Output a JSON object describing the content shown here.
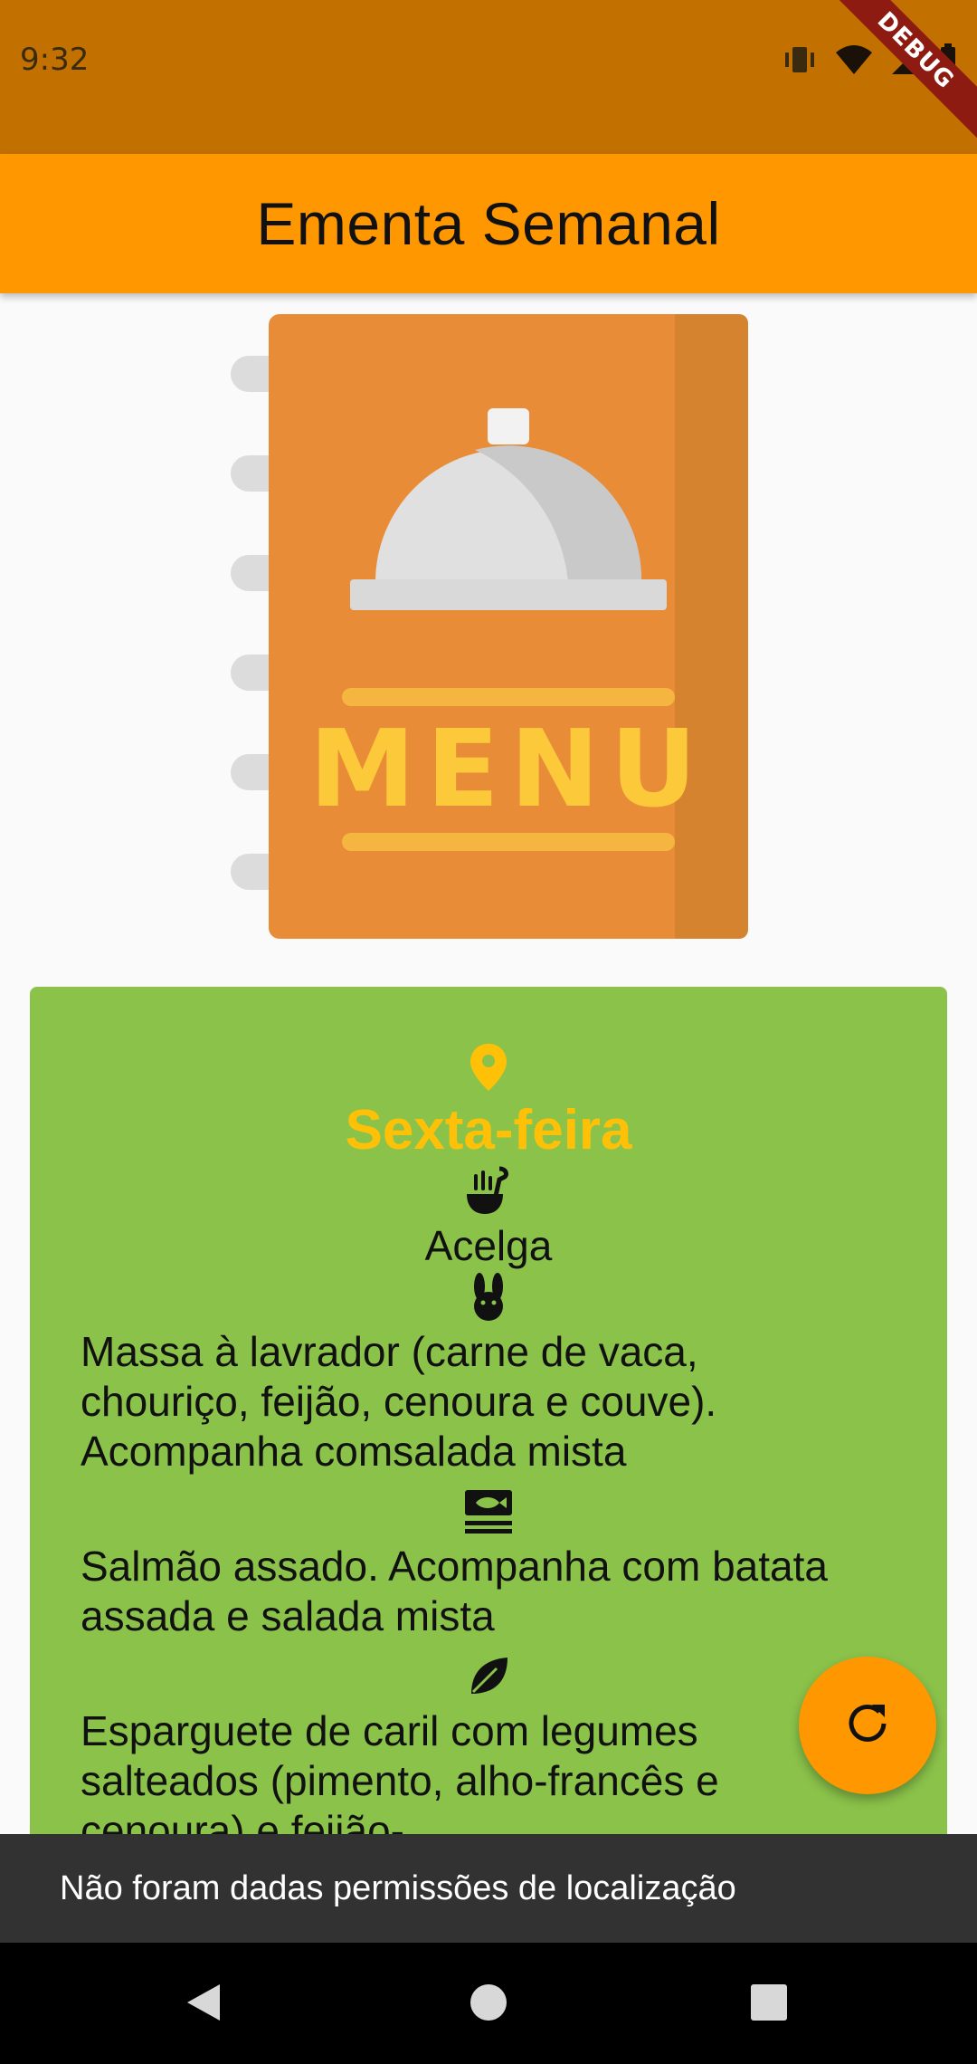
{
  "status_bar": {
    "time": "9:32",
    "icons": [
      "vibrate-icon",
      "wifi-icon",
      "signal-icon",
      "battery-icon"
    ]
  },
  "debug_banner": "DEBUG",
  "app_bar": {
    "title": "Ementa Semanal"
  },
  "menu_image": {
    "text": "MENU"
  },
  "card": {
    "day": "Sexta-feira",
    "location_icon": "location-pin-icon",
    "soup_icon": "soup-ladle-icon",
    "soup": "Acelga",
    "meat_icon": "rabbit-icon",
    "meat_lines": [
      "Massa à lavrador (carne de vaca,",
      "chouriço, feijão, cenoura e couve).",
      "Acompanha comsalada mista"
    ],
    "fish_icon": "fish-icon",
    "fish_lines": [
      "Salmão assado. Acompanha com batata",
      "assada e salada mista"
    ],
    "veg_icon": "leaf-icon",
    "veg_lines": [
      "Esparguete de caril com legumes",
      "salteados (pimento, alho-francês e",
      "cenoura) e feijão-"
    ]
  },
  "fab": {
    "icon": "refresh-icon"
  },
  "snackbar": {
    "message": "Não foram dadas permissões de localização"
  },
  "nav_bar": {
    "buttons": [
      "back-icon",
      "home-icon",
      "recents-icon"
    ]
  },
  "colors": {
    "status_bar": "#c27100",
    "app_bar": "#ff9800",
    "card": "#8bc34a",
    "day_title": "#ffc107",
    "snackbar": "#323232"
  }
}
